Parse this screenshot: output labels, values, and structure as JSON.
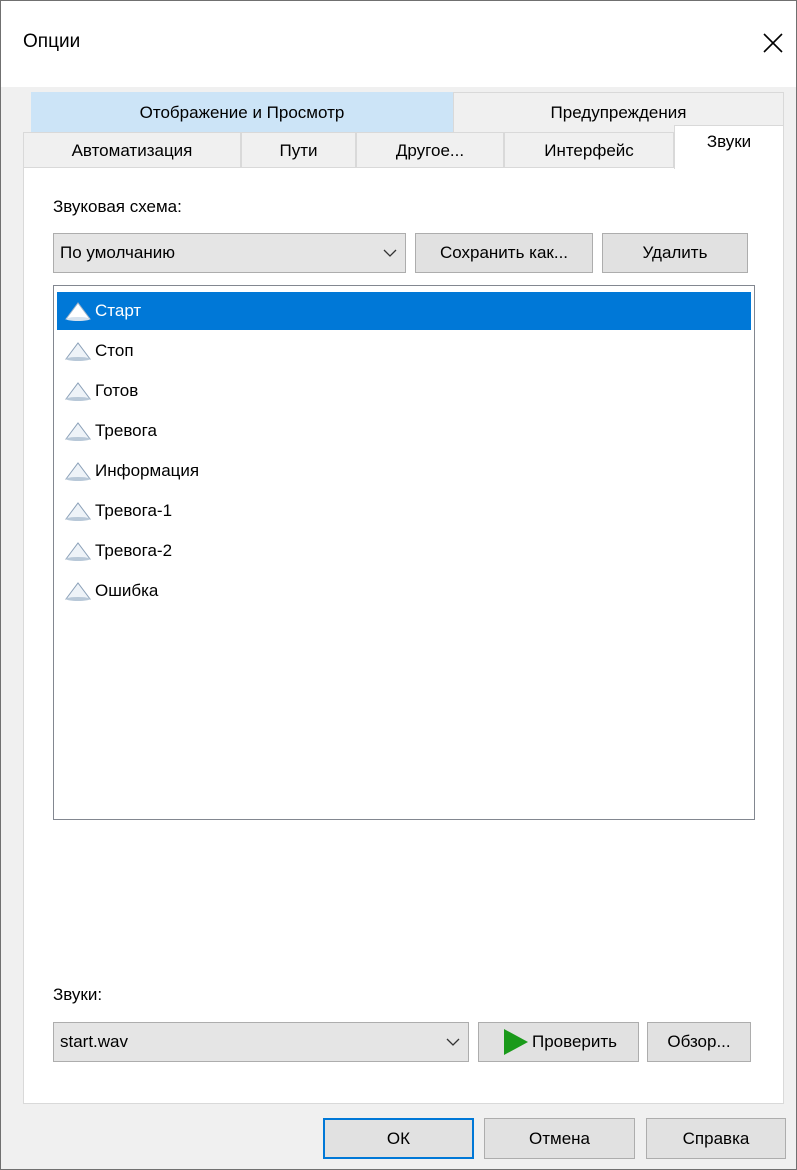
{
  "window": {
    "title": "Опции"
  },
  "tabs": {
    "row1": [
      {
        "label": "Отображение и Просмотр"
      },
      {
        "label": "Предупреждения"
      }
    ],
    "row2": [
      {
        "label": "Автоматизация"
      },
      {
        "label": "Пути"
      },
      {
        "label": "Другое..."
      },
      {
        "label": "Интерфейс"
      },
      {
        "label": "Звуки"
      }
    ],
    "active": "Звуки",
    "highlighted": "Отображение и Просмотр"
  },
  "scheme": {
    "label": "Звуковая схема:",
    "selected": "По умолчанию",
    "save_as_label": "Сохранить как...",
    "delete_label": "Удалить"
  },
  "events": {
    "items": [
      {
        "label": "Старт"
      },
      {
        "label": "Стоп"
      },
      {
        "label": "Готов"
      },
      {
        "label": "Тревога"
      },
      {
        "label": "Информация"
      },
      {
        "label": "Тревога-1"
      },
      {
        "label": "Тревога-2"
      },
      {
        "label": "Ошибка"
      }
    ],
    "selected_index": 0,
    "icon": "speaker-icon"
  },
  "sounds": {
    "label": "Звуки:",
    "selected": "start.wav",
    "test_label": "Проверить",
    "browse_label": "Обзор..."
  },
  "footer": {
    "ok_label": "ОК",
    "cancel_label": "Отмена",
    "help_label": "Справка"
  },
  "colors": {
    "accent": "#0078d7",
    "play": "#1a9a1a",
    "tab_highlight": "#cce4f7"
  }
}
